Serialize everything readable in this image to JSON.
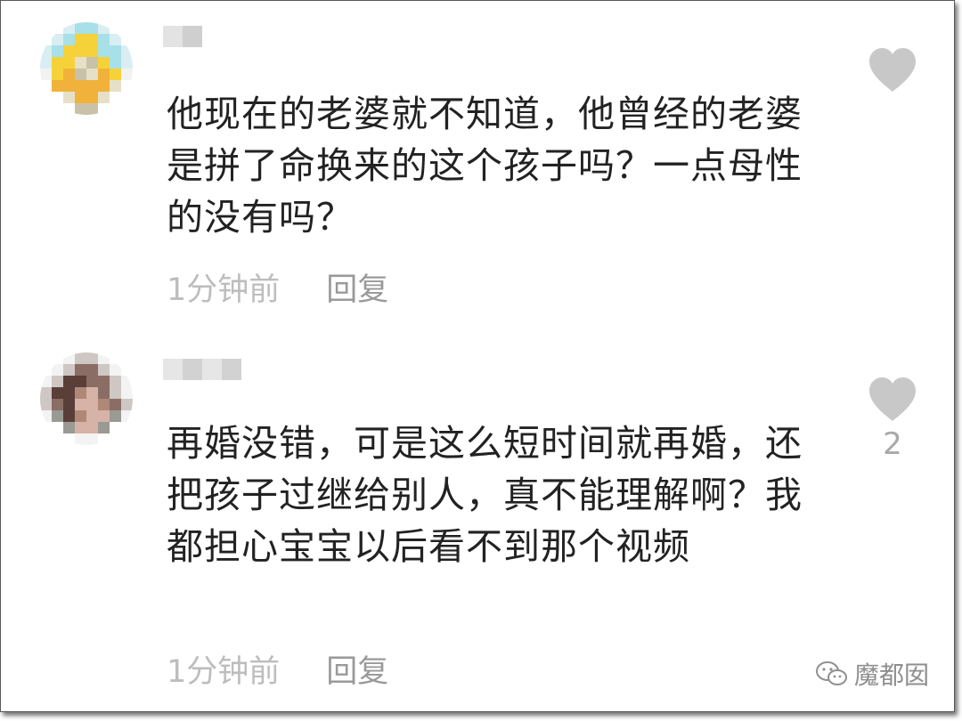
{
  "comments": [
    {
      "text": "他现在的老婆就不知道，他曾经的老婆是拼了命换来的这个孩子吗？一点母性的没有吗？",
      "time": "1分钟前",
      "reply_label": "回复",
      "like_count": "",
      "avatar_palette": [
        "#f2f2f2",
        "#d9eef2",
        "#a7e0e8",
        "#f6d23a",
        "#f0b23a",
        "#e6e0c8",
        "#c9c2a8",
        "#ffffff"
      ],
      "username_palette": [
        "#e3e3e3",
        "#cfcfcf"
      ]
    },
    {
      "text": "再婚没错，可是这么短时间就再婚，还把孩子过继给别人，真不能理解啊？我都担心宝宝以后看不到那个视频",
      "time": "1分钟前",
      "reply_label": "回复",
      "like_count": "2",
      "avatar_palette": [
        "#f3f3f3",
        "#cfc7c3",
        "#8a6d64",
        "#5a3f38",
        "#b08878",
        "#d6b3a6",
        "#9a9a94",
        "#ffffff"
      ],
      "username_palette": [
        "#e6e6e6",
        "#d2d2d2"
      ]
    }
  ],
  "colors": {
    "text": "#222222",
    "meta": "#b3b3b3",
    "like_icon": "#c8c8c8"
  },
  "icons": {
    "like": "heart-icon",
    "watermark": "wechat-icon"
  },
  "watermark": {
    "text": "魔都囡"
  }
}
